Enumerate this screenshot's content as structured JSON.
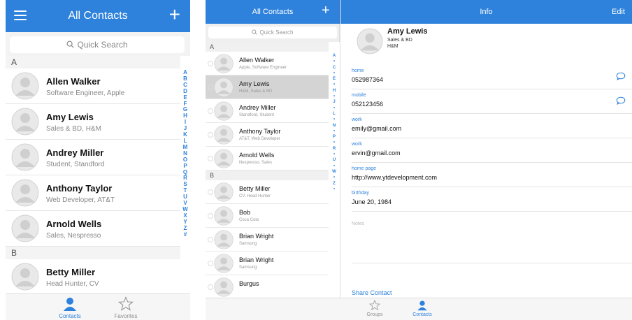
{
  "colors": {
    "accent": "#2e82dc",
    "inactive": "#8e8e93",
    "selected_row": "#d4d4d4"
  },
  "phone": {
    "title": "All Contacts",
    "menu_icon": "hamburger-menu-icon",
    "add_label": "+",
    "search_placeholder": "Quick Search",
    "sections": [
      {
        "letter": "A",
        "contacts": [
          {
            "name": "Allen Walker",
            "subtitle": "Software Engineer, Apple"
          },
          {
            "name": "Amy Lewis",
            "subtitle": "Sales & BD, H&M"
          },
          {
            "name": "Andrey Miller",
            "subtitle": "Student, Standford"
          },
          {
            "name": "Anthony Taylor",
            "subtitle": "Web Developer, AT&T"
          },
          {
            "name": "Arnold Wells",
            "subtitle": "Sales, Nespresso"
          }
        ]
      },
      {
        "letter": "B",
        "contacts": [
          {
            "name": "Betty Miller",
            "subtitle": "Head Hunter, CV"
          }
        ]
      }
    ],
    "index": [
      "A",
      "B",
      "C",
      "D",
      "E",
      "F",
      "G",
      "H",
      "I",
      "J",
      "K",
      "L",
      "M",
      "N",
      "O",
      "P",
      "Q",
      "R",
      "S",
      "T",
      "U",
      "V",
      "W",
      "X",
      "Y",
      "Z",
      "#"
    ],
    "tabs": [
      {
        "label": "Contacts",
        "icon": "person-icon",
        "active": true
      },
      {
        "label": "Favorites",
        "icon": "star-icon",
        "active": false
      }
    ]
  },
  "tablet": {
    "list_title": "All Contacts",
    "add_label": "+",
    "detail_title": "Info",
    "edit_label": "Edit",
    "search_placeholder": "Quick Search",
    "sections": [
      {
        "letter": "A",
        "contacts": [
          {
            "name": "Allen Walker",
            "subtitle": "Apple, Software Engineer",
            "selected": false
          },
          {
            "name": "Amy Lewis",
            "subtitle": "H&M, Sales & BD",
            "selected": true
          },
          {
            "name": "Andrey Miller",
            "subtitle": "Standford, Student",
            "selected": false
          },
          {
            "name": "Anthony Taylor",
            "subtitle": "AT&T, Web Developer",
            "selected": false
          },
          {
            "name": "Arnold Wells",
            "subtitle": "Nespresso, Sales",
            "selected": false
          }
        ]
      },
      {
        "letter": "B",
        "contacts": [
          {
            "name": "Betty Miller",
            "subtitle": "CV, Head Hunter",
            "selected": false
          },
          {
            "name": "Bob",
            "subtitle": "Coca Cola",
            "selected": false
          },
          {
            "name": "Brian Wright",
            "subtitle": "Samsung",
            "selected": false
          },
          {
            "name": "Brian Wright",
            "subtitle": "Samsung",
            "selected": false
          },
          {
            "name": "Burgus",
            "subtitle": "",
            "selected": false
          }
        ]
      }
    ],
    "index": [
      "A",
      "•",
      "C",
      "•",
      "E",
      "•",
      "H",
      "•",
      "J",
      "•",
      "L",
      "•",
      "N",
      "•",
      "P",
      "•",
      "R",
      "•",
      "U",
      "•",
      "W",
      "•",
      "Z",
      "•"
    ],
    "detail": {
      "name": "Amy Lewis",
      "role": "Sales & BD",
      "company": "H&M",
      "fields": [
        {
          "label": "home",
          "value": "052987364",
          "has_message": true
        },
        {
          "label": "mobile",
          "value": "052123456",
          "has_message": true
        },
        {
          "label": "work",
          "value": "emily@gmail.com",
          "has_message": false
        },
        {
          "label": "work",
          "value": "ervin@gmail.com",
          "has_message": false
        },
        {
          "label": "home page",
          "value": "http://www.ytdevelopment.com",
          "has_message": false
        },
        {
          "label": "birthday",
          "value": "June 20, 1984",
          "has_message": false
        }
      ],
      "notes_label": "Notes",
      "share_label": "Share Contact"
    },
    "tabs": [
      {
        "label": "Groups",
        "icon": "star-icon",
        "active": false
      },
      {
        "label": "Contacts",
        "icon": "person-icon",
        "active": true
      }
    ]
  }
}
